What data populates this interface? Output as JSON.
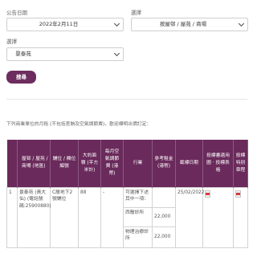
{
  "filters": {
    "date_label": "公告日期",
    "date_value": "2022年2月11日",
    "option_label": "選擇",
    "option_value": "按屋邨 / 屋苑 / 商場",
    "option2_label": "選擇",
    "option2_value": "景泰苑",
    "search_label": "搜尋"
  },
  "note": "下列商業單位的月租 (不包括差餉及空氣調節費)，歡迎標明出價訂定：",
  "table": {
    "headers": [
      "",
      "屋邨 / 屋苑 / 商場 (地區)",
      "鋪位 / 欄位編號",
      "大約面積 (平方米計)",
      "每月空氣調節費 (港幣)",
      "行業",
      "參考租金 (港幣)",
      "截標日期",
      "投標書適用圖 · 投標表格",
      "投標特別章程"
    ],
    "row": {
      "index": "1",
      "estate_link": "景泰苑 (黃大仙) (電話號碼:25900880)",
      "shop_no": "C層地下2號鋪位",
      "area": "88",
      "ac_fee": "-",
      "trades": [
        {
          "trade": "可選擇下述其中一項：",
          "rent": ""
        },
        {
          "trade": "西醫診所",
          "rent": "22,000"
        },
        {
          "trade": "物理治療診所",
          "rent": "22,000"
        }
      ],
      "closing_date": "25/02/2022"
    }
  }
}
